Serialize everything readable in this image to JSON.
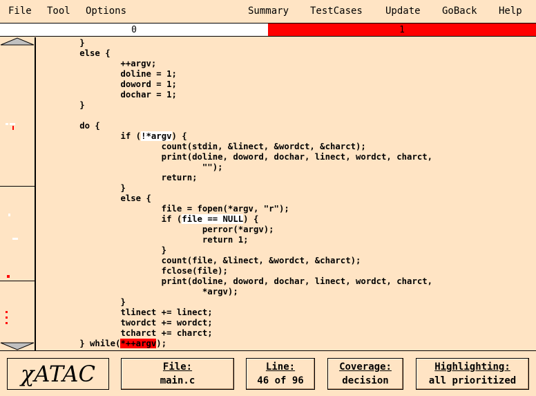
{
  "menu": {
    "left": [
      {
        "label": "File"
      },
      {
        "label": "Tool"
      },
      {
        "label": "Options"
      }
    ],
    "right": [
      {
        "label": "Summary"
      },
      {
        "label": "TestCases"
      },
      {
        "label": "Update"
      },
      {
        "label": "GoBack"
      },
      {
        "label": "Help"
      }
    ]
  },
  "progress": {
    "left_value": "0",
    "right_value": "1",
    "left_fraction": 0.5,
    "colors": {
      "left": "#ffffff",
      "right": "#ff0000"
    }
  },
  "code_lines": [
    "\t}",
    "\telse {",
    "\t\t++argv;",
    "\t\tdoline = 1;",
    "\t\tdoword = 1;",
    "\t\tdochar = 1;",
    "\t}",
    "",
    "\tdo {",
    "\t\tif (!*argv) {",
    "\t\t\tcount(stdin, &linect, &wordct, &charct);",
    "\t\t\tprint(doline, doword, dochar, linect, wordct, charct,",
    "\t\t\t\t\"\");",
    "\t\t\treturn;",
    "\t\t}",
    "\t\telse {",
    "\t\t\tfile = fopen(*argv, \"r\");",
    "\t\t\tif (file == NULL) {",
    "\t\t\t\tperror(*argv);",
    "\t\t\t\treturn 1;",
    "\t\t\t}",
    "\t\t\tcount(file, &linect, &wordct, &charct);",
    "\t\t\tfclose(file);",
    "\t\t\tprint(doline, doword, dochar, linect, wordct, charct,",
    "\t\t\t\t*argv);",
    "\t\t}",
    "\t\ttlinect += linect;",
    "\t\ttwordct += wordct;",
    "\t\ttcharct += charct;",
    "\t} while(*++argv);"
  ],
  "highlights": {
    "white": [
      "!*argv",
      "file == NULL"
    ],
    "red": [
      "*++argv"
    ],
    "colors": {
      "white": "#ffffff",
      "red": "#ff0000"
    }
  },
  "status": {
    "logo": "χATAC",
    "file": {
      "title": "File:",
      "value": "main.c"
    },
    "line": {
      "title": "Line:",
      "value": "46 of 96"
    },
    "coverage": {
      "title": "Coverage:",
      "value": "decision"
    },
    "highlighting": {
      "title": "Highlighting:",
      "value": "all prioritized"
    }
  },
  "icons": {
    "scroll_up": "triangle-up-icon",
    "scroll_down": "triangle-down-icon"
  },
  "colors": {
    "background": "#ffe4c4"
  }
}
